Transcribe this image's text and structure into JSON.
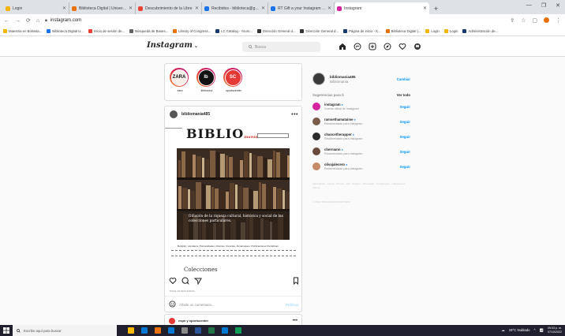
{
  "browser": {
    "tabs": [
      {
        "label": "Login",
        "color": "#f4b400"
      },
      {
        "label": "Biblioteca Digital | Universidad d",
        "color": "#e8710a"
      },
      {
        "label": "Descubrimiento de la Libre",
        "color": "#ea4335"
      },
      {
        "label": "Recibidos - biblioteca@gmail.com",
        "color": "#1a73e8"
      },
      {
        "label": "RT Gift a your Instagram cuve",
        "color": "#1a73e8"
      },
      {
        "label": "Instagram",
        "color": "#d6249f",
        "active": true
      }
    ],
    "new_tab": "+",
    "url": "instagram.com",
    "bookmarks": [
      {
        "label": "Maestria en Bolsista...",
        "color": "#f4b400"
      },
      {
        "label": "Biblioteca Digital U...",
        "color": "#1a73e8"
      },
      {
        "label": "Inicio de sesión de...",
        "color": "#ea4335"
      },
      {
        "label": "Búsqueda de Bases...",
        "color": "#5f6368"
      },
      {
        "label": "Library of Congress...",
        "color": "#e8710a"
      },
      {
        "label": "LC Catalog - Yours...",
        "color": "#1a3a6b"
      },
      {
        "label": "Dirección General d...",
        "color": "#333333"
      },
      {
        "label": "Dirección General d...",
        "color": "#333333"
      },
      {
        "label": "Página de inicio - K...",
        "color": "#1a3a6b"
      },
      {
        "label": "Biblioteca Digital |...",
        "color": "#e8710a"
      },
      {
        "label": "Login",
        "color": "#f4b400"
      },
      {
        "label": "Login",
        "color": "#f4b400"
      },
      {
        "label": "Administración de...",
        "color": "#1a3a6b"
      }
    ]
  },
  "instagram": {
    "logo": "Instagram",
    "search_placeholder": "Busca",
    "stories": [
      {
        "name": "zara",
        "initials": "ZARA",
        "bg": "#f7f0ea",
        "fg": "#111111"
      },
      {
        "name": "librbound",
        "initials": "lb",
        "bg": "#111111",
        "fg": "#ffffff"
      },
      {
        "name": "sportscenter",
        "initials": "SC",
        "bg": "#e53935",
        "fg": "#ffffff"
      }
    ],
    "post": {
      "username": "bibliomania485",
      "brand": "BIBLIO",
      "brand_suffix": "manía",
      "overlay_text": "Difusión de la riqueza cultural, histórica y social de las colecciones particulares.",
      "caption": "Religión, Literatura, Humanidades, Idiomas, Ciencias, Almanaques, Publicaciones Periódicas",
      "collection_label": "Colecciones",
      "time": "HACE 18 SEGUNDOS",
      "comment_placeholder": "Añade un comentario...",
      "publish": "Publicar"
    },
    "next_post": {
      "username": "espn y sportscenter"
    },
    "sidebar": {
      "username": "bibliomania485",
      "name": "Bibliomania",
      "change": "Cambiar",
      "suggestions_title": "Sugerencias para ti",
      "see_all": "Ver todo",
      "suggestions": [
        {
          "username": "instagram",
          "subtitle": "Cuenta oficial de Instagram",
          "color": "#d6249f",
          "follow": "Seguir"
        },
        {
          "username": "ramsethamataime",
          "subtitle": "Recomendado para Instagram",
          "color": "#7a5c4a",
          "follow": "Seguir"
        },
        {
          "username": "chancetherapper",
          "subtitle": "Recomendado para Instagram",
          "color": "#2b2b2b",
          "follow": "Seguir"
        },
        {
          "username": "chermann",
          "subtitle": "Recomendado para Instagram",
          "color": "#6a4a3a",
          "follow": "Seguir"
        },
        {
          "username": "olivajalecero",
          "subtitle": "Recomendado para Instagram",
          "color": "#c48a6a",
          "follow": "Seguir"
        }
      ],
      "footer_links": "Información · Ayuda · Prensa · API · Empleo · Privacidad · Condiciones · Ubicaciones · Idioma",
      "copyright": "© 2022 INSTAGRAM FROM META"
    }
  },
  "taskbar": {
    "search_placeholder": "Escribe aquí para buscar",
    "weather": "19°C Nublado",
    "time": "09:03 p. m.",
    "date": "07/10/2022",
    "apps": [
      "#ffb900",
      "#0078d4",
      "#e8710a",
      "#0078d4",
      "#8a8a8a",
      "#2b579a",
      "#217346",
      "#0078d4",
      "#0f9d58"
    ]
  }
}
